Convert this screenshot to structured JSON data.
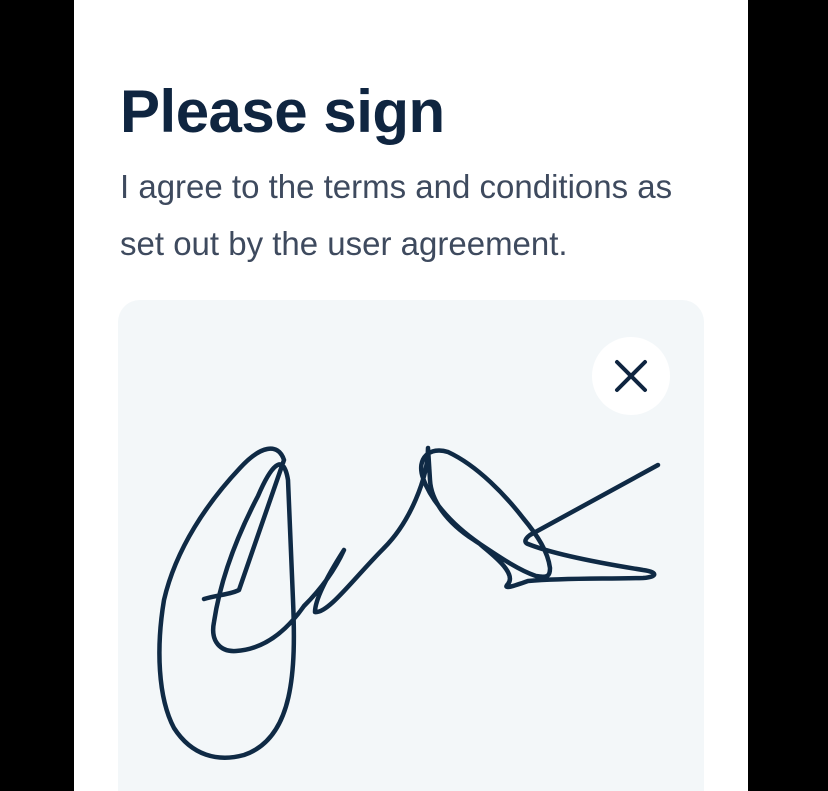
{
  "screen": {
    "title": "Please sign",
    "subtitle": "I agree to the terms and conditions as set out by the user agreement."
  },
  "signature_pad": {
    "clear_button_icon": "close-icon"
  },
  "colors": {
    "heading": "#0f2540",
    "body_text": "#3e4a5e",
    "pad_background": "#f3f7f9",
    "ink": "#0f2a45",
    "outer_background": "#000000"
  }
}
